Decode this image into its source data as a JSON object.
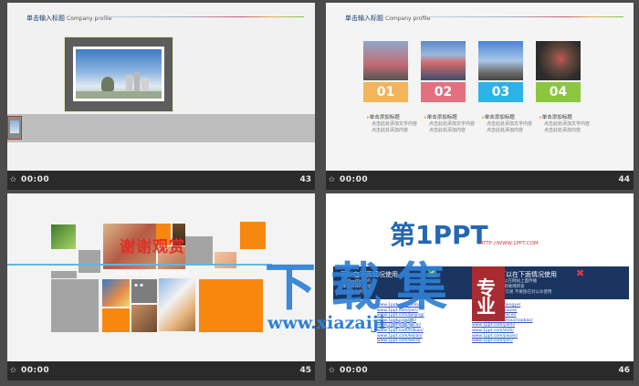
{
  "slides": [
    {
      "number": "43",
      "time": "00:00",
      "title": "单击输入标题",
      "subtitle_en": "Company profile"
    },
    {
      "number": "44",
      "time": "00:00",
      "title": "单击输入标题",
      "subtitle_en": "Company profile",
      "cards": [
        {
          "num": "01",
          "heading": "单击添加标题",
          "body": [
            "点击此处添加文字内容",
            "点击此处添加内容"
          ],
          "color": "#f2b55a"
        },
        {
          "num": "02",
          "heading": "单击添加标题",
          "body": [
            "点击此处添加文字内容",
            "点击此处添加内容"
          ],
          "color": "#e4707f"
        },
        {
          "num": "03",
          "heading": "单击添加标题",
          "body": [
            "点击此处添加文字内容",
            "点击此处添加内容"
          ],
          "color": "#2cb3e8"
        },
        {
          "num": "04",
          "heading": "单击添加标题",
          "body": [
            "点击此处添加文字内容",
            "点击此处添加内容"
          ],
          "color": "#8cc63f"
        }
      ]
    },
    {
      "number": "45",
      "time": "00:00",
      "thanks": "谢谢观赏",
      "sub": "点击 添加 文字 说明 内容 文化"
    },
    {
      "number": "46",
      "time": "00:00",
      "logo_main": "第1PPT",
      "logo_url": "HTTP://WWW.1PPT.COM",
      "banner_left": "可以在下面情况使用",
      "banner_right": "不可以在下面情况使用",
      "bullets_left": [
        "一对一对分享的",
        "来来去去的分享",
        "来来去去的分享"
      ],
      "bullets_right": [
        "不可以在网站上面传播",
        "分享到微博转发",
        "转发 交易 不要放在对公众使用"
      ],
      "links_left": [
        "www.1ppt.com/moban/",
        "www.1ppt.com/jieri/",
        "www.1ppt.com/beijing/",
        "www.1ppt.com/ziti/",
        "www.1ppt.com/sucai/",
        "www.1ppt.com/tubiao/",
        "www.1ppt.com/kejian/",
        "www.1ppt.com/word/"
      ],
      "links_right": [
        "www.1ppt.com/hangye/",
        "www.1ppt.com/xiazai/",
        "www.1ppt.com/excel/",
        "www.1ppt.com/shouchaobao/",
        "www.1ppt.com/jianli/",
        "www.1ppt.com/shiti/",
        "www.1ppt.com/jiaoan/",
        "www.1ppt.com/jieri/"
      ],
      "watermark_big": "下载集",
      "watermark_url": "www.xiazaiji",
      "watermark_suffix": ".ed",
      "seal_text": "专业"
    }
  ],
  "colors": {
    "bar_bg": "#2a2a2a",
    "app_bg": "#4b4b4b",
    "banner": "#1b3561",
    "logo_blue": "#2567b3",
    "logo_red": "#d7373a"
  }
}
